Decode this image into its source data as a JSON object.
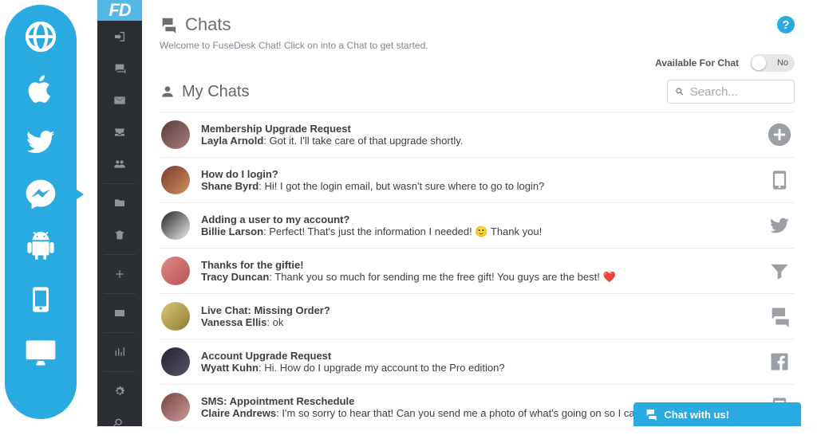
{
  "header": {
    "title": "Chats",
    "welcome": "Welcome to FuseDesk Chat! Click on into a Chat to get started.",
    "my_chats": "My Chats"
  },
  "availability": {
    "label": "Available For Chat",
    "value": "No"
  },
  "search": {
    "placeholder": "Search..."
  },
  "chat_with_us": "Chat with us!",
  "chats": [
    {
      "subject": "Membership Upgrade Request",
      "from": "Layla Arnold",
      "preview": "Got it. I'll take care of that upgrade shortly."
    },
    {
      "subject": "How do I login?",
      "from": "Shane Byrd",
      "preview": "Hi! I got the login email, but wasn't sure where to go to login?"
    },
    {
      "subject": "Adding a user to my account?",
      "from": "Billie Larson",
      "preview": "Perfect! That's just the information I needed! 🙂 Thank you!"
    },
    {
      "subject": "Thanks for the giftie!",
      "from": "Tracy Duncan",
      "preview": "Thank you so much for sending me the free gift! You guys are the best! ❤️"
    },
    {
      "subject": "Live Chat: Missing Order?",
      "from": "Vanessa Ellis",
      "preview": "ok"
    },
    {
      "subject": "Account Upgrade Request",
      "from": "Wyatt Kuhn",
      "preview": "Hi. How do I upgrade my account to the Pro edition?"
    },
    {
      "subject": "SMS: Appointment Reschedule",
      "from": "Claire Andrews",
      "preview": "I'm so sorry to hear that! Can you send me a photo of what's going on so I can take a closer look?"
    }
  ]
}
